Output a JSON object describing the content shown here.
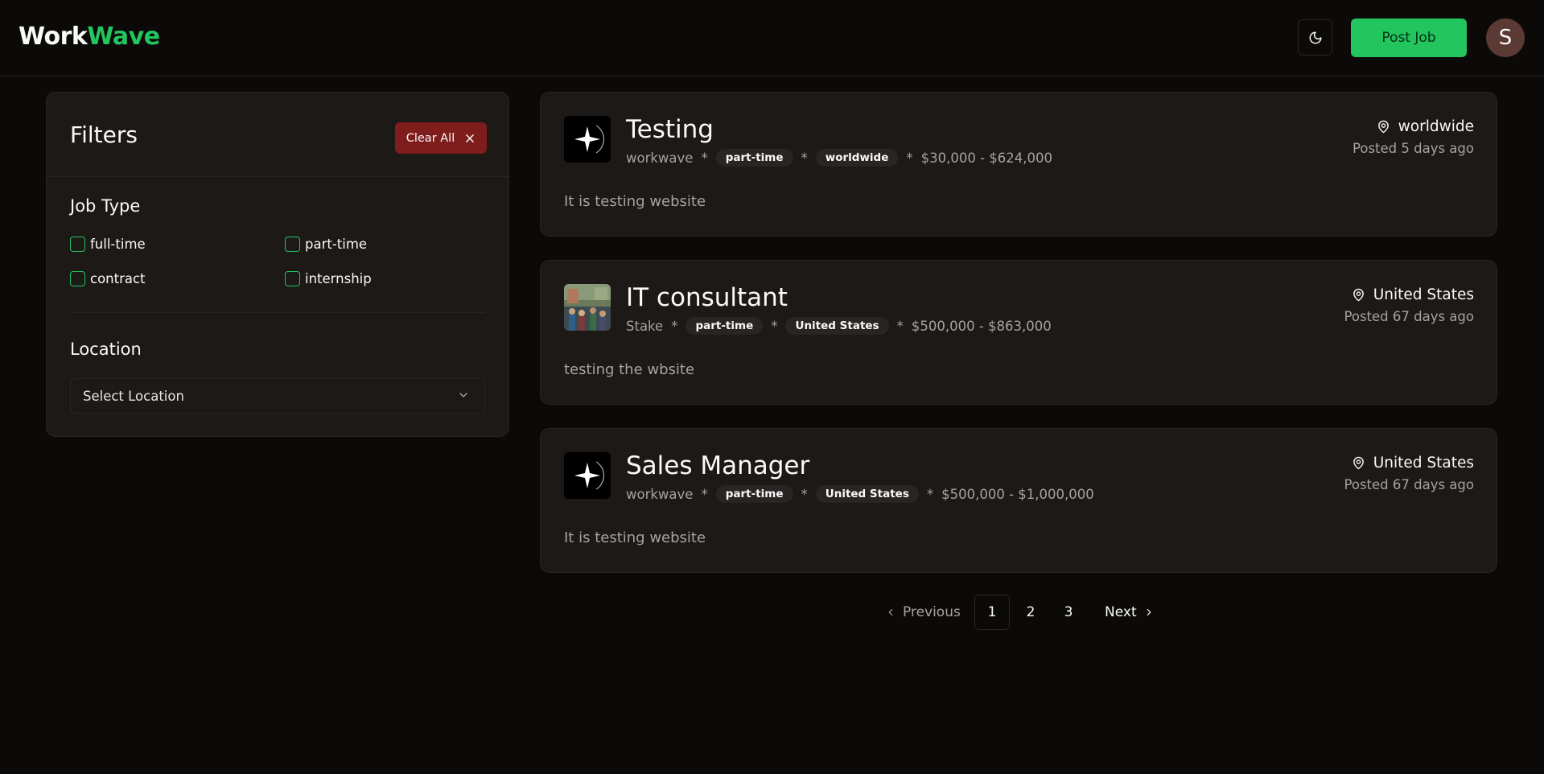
{
  "header": {
    "logo_part1": "Work",
    "logo_part2": "Wave",
    "theme_icon": "moon-icon",
    "post_job_label": "Post Job",
    "avatar_initial": "S"
  },
  "filters": {
    "title": "Filters",
    "clear_label": "Clear All",
    "job_type_title": "Job Type",
    "job_types": [
      "full-time",
      "part-time",
      "contract",
      "internship"
    ],
    "location_title": "Location",
    "location_placeholder": "Select Location"
  },
  "jobs": [
    {
      "title": "Testing",
      "company": "workwave",
      "type": "part-time",
      "location_tag": "worldwide",
      "salary": "$30,000 - $624,000",
      "location": "worldwide",
      "posted": "Posted 5 days ago",
      "description": "It is testing website",
      "logo": "sparkle-logo"
    },
    {
      "title": "IT consultant",
      "company": "Stake",
      "type": "part-time",
      "location_tag": "United States",
      "salary": "$500,000 - $863,000",
      "location": "United States",
      "posted": "Posted 67 days ago",
      "description": "testing the wbsite",
      "logo": "photo-logo"
    },
    {
      "title": "Sales Manager",
      "company": "workwave",
      "type": "part-time",
      "location_tag": "United States",
      "salary": "$500,000 - $1,000,000",
      "location": "United States",
      "posted": "Posted 67 days ago",
      "description": "It is testing website",
      "logo": "sparkle-logo"
    }
  ],
  "pagination": {
    "previous_label": "Previous",
    "pages": [
      "1",
      "2",
      "3"
    ],
    "current_page": "1",
    "next_label": "Next"
  },
  "colors": {
    "background": "#0c0a09",
    "card": "#1c1917",
    "accent": "#22c55e",
    "danger": "#7f1d1d"
  }
}
